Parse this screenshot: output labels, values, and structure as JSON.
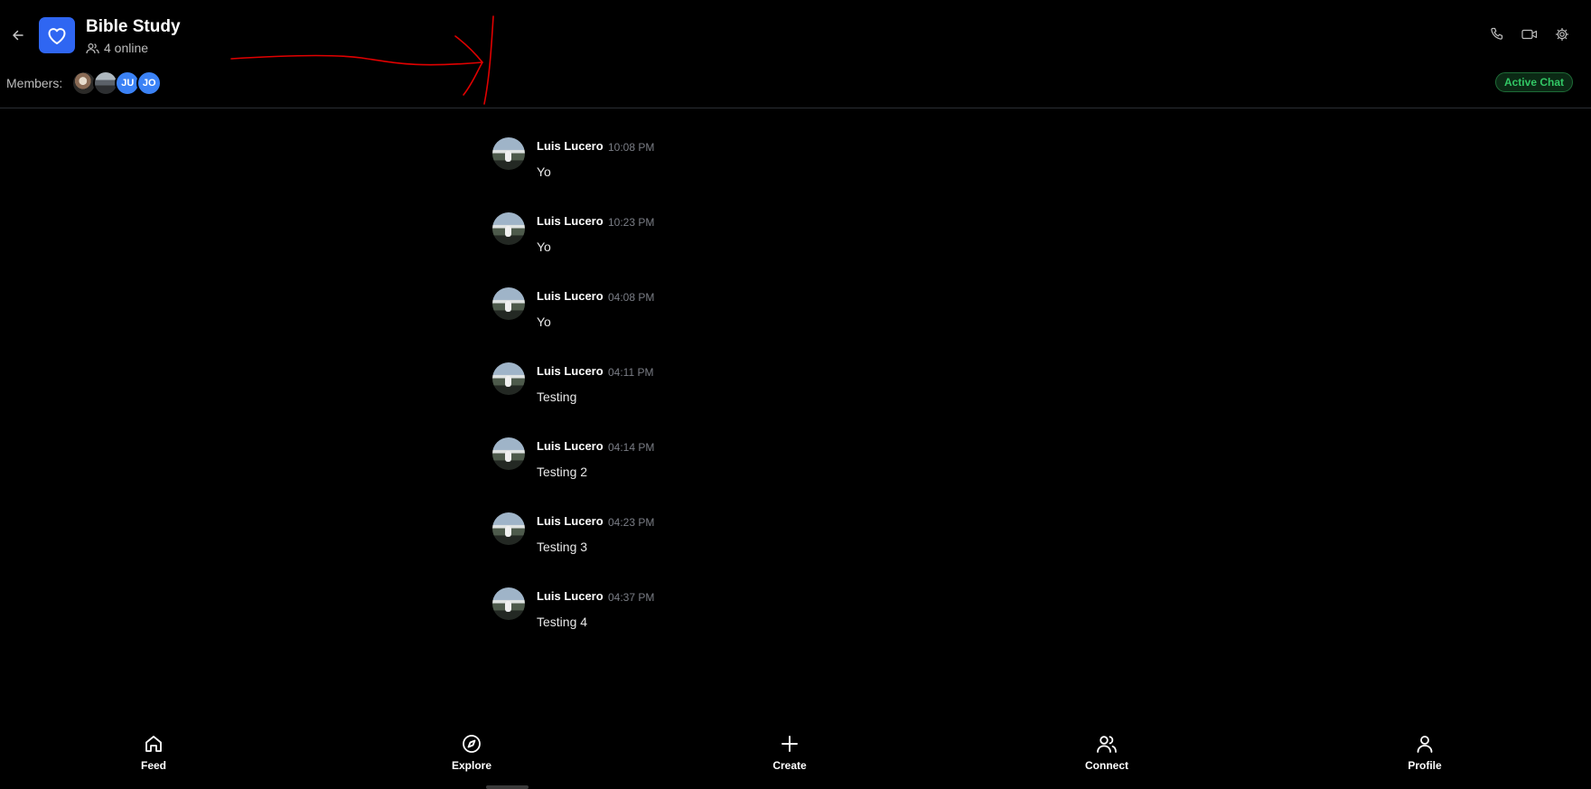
{
  "header": {
    "title": "Bible Study",
    "online_text": "4 online",
    "members_label": "Members:",
    "members": [
      {
        "type": "photo",
        "name": "member-avatar-1"
      },
      {
        "type": "photo",
        "name": "member-avatar-2"
      },
      {
        "type": "initials",
        "initials": "JU"
      },
      {
        "type": "initials",
        "initials": "JO"
      }
    ],
    "status_badge": "Active Chat",
    "icons": [
      "back-arrow-icon",
      "heart-icon",
      "users-icon",
      "phone-icon",
      "video-icon",
      "gear-icon"
    ]
  },
  "messages": [
    {
      "author": "Luis Lucero",
      "time": "10:08 PM",
      "text": "Yo"
    },
    {
      "author": "Luis Lucero",
      "time": "10:23 PM",
      "text": "Yo"
    },
    {
      "author": "Luis Lucero",
      "time": "04:08 PM",
      "text": "Yo"
    },
    {
      "author": "Luis Lucero",
      "time": "04:11 PM",
      "text": "Testing"
    },
    {
      "author": "Luis Lucero",
      "time": "04:14 PM",
      "text": "Testing 2"
    },
    {
      "author": "Luis Lucero",
      "time": "04:23 PM",
      "text": "Testing 3"
    },
    {
      "author": "Luis Lucero",
      "time": "04:37 PM",
      "text": "Testing 4"
    }
  ],
  "bottom_nav": [
    {
      "label": "Feed",
      "icon": "home-icon"
    },
    {
      "label": "Explore",
      "icon": "compass-icon"
    },
    {
      "label": "Create",
      "icon": "plus-icon"
    },
    {
      "label": "Connect",
      "icon": "users-icon"
    },
    {
      "label": "Profile",
      "icon": "user-icon"
    }
  ],
  "colors": {
    "background": "#000000",
    "accent": "#2f66f2",
    "member_initials_bg": "#3b82f6",
    "active_badge_text": "#32c765",
    "annotation_stroke": "#e00000",
    "timestamp": "#7a7d85"
  }
}
